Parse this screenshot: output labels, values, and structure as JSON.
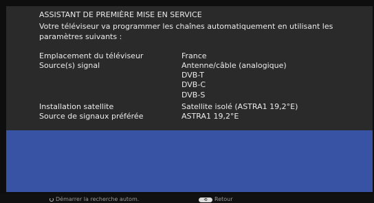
{
  "header": {
    "title": "ASSISTANT DE PREMIÈRE MISE EN SERVICE",
    "description": "Votre téléviseur va programmer les chaînes automatiquement en utilisant les paramètres suivants :"
  },
  "settings": {
    "location_label": "Emplacement du téléviseur",
    "location_value": "France",
    "source_label": "Source(s) signal",
    "sources": [
      "Antenne/câble (analogique)",
      "DVB-T",
      "DVB-C",
      "DVB-S"
    ],
    "satellite_label": "Installation satellite",
    "satellite_value": "Satellite isolé (ASTRA1 19,2°E)",
    "preferred_label": "Source de signaux préférée",
    "preferred_value": "ASTRA1 19,2°E"
  },
  "footer": {
    "start_label": "Démarrer la recherche autom.",
    "start_icon": "power-icon",
    "back_label": "Retour",
    "back_icon": "back-key-icon",
    "back_key_text": "⟲"
  },
  "colors": {
    "panel": "#2a2a2a",
    "accent_blue": "#3953a4"
  }
}
